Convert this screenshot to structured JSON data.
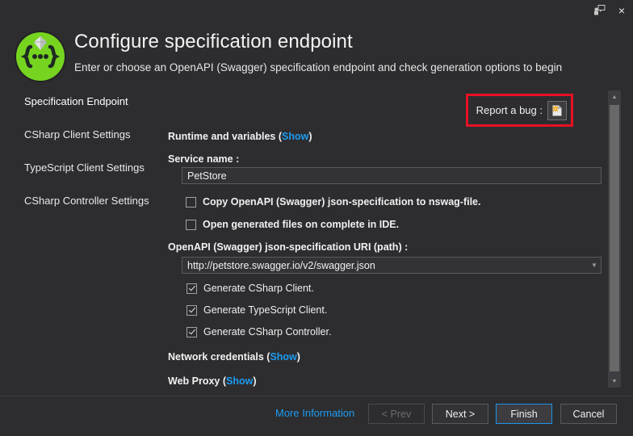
{
  "window": {
    "feedback_icon": "feedback-icon",
    "close_icon": "×"
  },
  "header": {
    "title": "Configure specification endpoint",
    "subtitle": "Enter or choose an OpenAPI (Swagger) specification endpoint and check generation options to begin",
    "logo_icon": "nswag-logo-icon",
    "logo_color": "#76d420"
  },
  "sidebar": {
    "items": [
      {
        "label": "Specification Endpoint",
        "active": true
      },
      {
        "label": "CSharp Client Settings",
        "active": false
      },
      {
        "label": "TypeScript Client Settings",
        "active": false
      },
      {
        "label": "CSharp Controller Settings",
        "active": false
      }
    ],
    "active_color": "#0c7cd5"
  },
  "content": {
    "report_bug": {
      "label": "Report a bug :",
      "icon": "report-bug-document-icon",
      "highlight_color": "#e81123"
    },
    "runtime_section": {
      "label": "Runtime and variables",
      "show_label": "Show"
    },
    "service_name": {
      "label": "Service name :",
      "value": "PetStore",
      "placeholder": ""
    },
    "options": [
      {
        "label": "Copy OpenAPI (Swagger) json-specification to nswag-file.",
        "checked": false
      },
      {
        "label": "Open generated files on complete in IDE.",
        "checked": false
      }
    ],
    "uri": {
      "label": "OpenAPI (Swagger) json-specification URI (path) :",
      "value": "http://petstore.swagger.io/v2/swagger.json"
    },
    "generate_options": [
      {
        "label": "Generate CSharp Client.",
        "checked": true
      },
      {
        "label": "Generate TypeScript Client.",
        "checked": true
      },
      {
        "label": "Generate CSharp Controller.",
        "checked": true
      }
    ],
    "network_section": {
      "label": "Network credentials",
      "show_label": "Show"
    },
    "proxy_section": {
      "label": "Web Proxy",
      "show_label": "Show"
    }
  },
  "scrollbar": {
    "up_arrow": "▲",
    "down_arrow": "▼"
  },
  "footer": {
    "more_information": "More Information",
    "prev_label": "< Prev",
    "next_label": "Next >",
    "finish_label": "Finish",
    "cancel_label": "Cancel",
    "focus_color": "#2094e8",
    "link_color": "#1e9bf0"
  }
}
